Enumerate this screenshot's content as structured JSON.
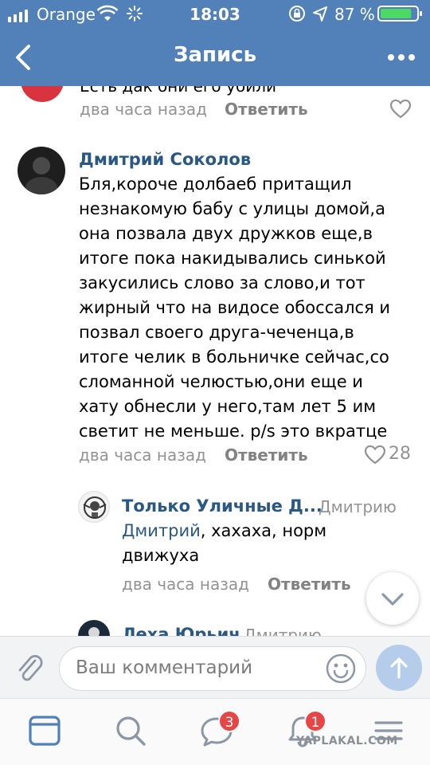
{
  "status_bar": {
    "carrier": "Orange",
    "time": "18:03",
    "battery_pct": "87 %",
    "battery_level": 0.87
  },
  "nav": {
    "title": "Запись"
  },
  "feed": {
    "clipped_text": "Есть дак они его убили",
    "clipped_comment": {
      "time": "два часа назад",
      "reply": "Ответить"
    },
    "comment": {
      "author": "Дмитрий Соколов",
      "lines": [
        "Бля,короче долбаеб притащил",
        "незнакомую бабу с улицы домой,а",
        "она позвала двух дружков еще,в",
        "итоге пока накидывались синькой",
        "закусились слово за слово,и тот",
        "жирный что на видосе обоссался и",
        "позвал своего друга-чеченца,в",
        "итоге челик в больничке сейчас,со",
        "сломанной челюстью,они еще и",
        "хату обнесли у него,там лет 5 им",
        "светит не меньше. p/s это вкратце"
      ],
      "time": "два часа назад",
      "reply": "Ответить",
      "likes": "28"
    },
    "reply1": {
      "author": "Только Уличные Д...",
      "to": "Дмитрию",
      "mention": "Дмитрий",
      "text_line1": ", хахаха, норм",
      "text_line2": "движуха",
      "time": "два часа назад",
      "reply": "Ответить"
    },
    "reply2": {
      "author": "Леха Юрьич",
      "to": "Дмитрию"
    }
  },
  "composer": {
    "placeholder": "Ваш комментарий"
  },
  "tabs": {
    "messages_badge": "3",
    "notifications_badge": "1"
  },
  "watermark": "YAPLAKAL.COM",
  "colors": {
    "header": "#5181b8",
    "link": "#2a5885",
    "badge": "#e64646"
  }
}
